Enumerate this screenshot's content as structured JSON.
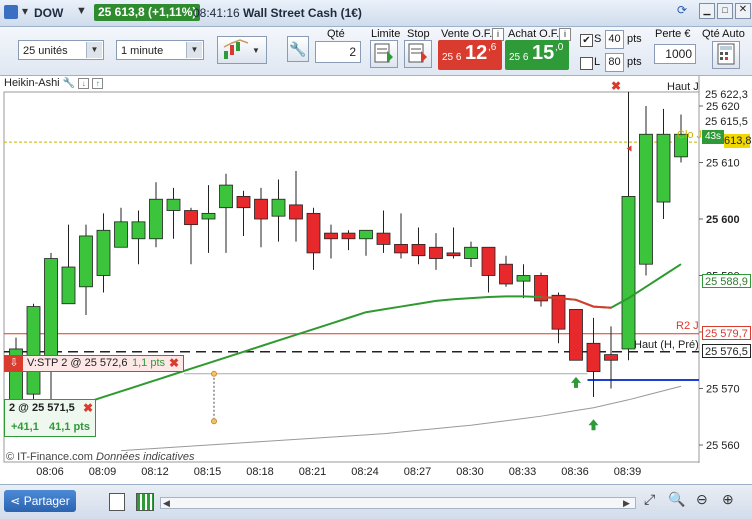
{
  "title_bar": {
    "instrument": "DOW",
    "price_change": "25 613,8 (+1,11%)",
    "time": "08:41:16",
    "name": "Wall Street Cash (1€)"
  },
  "toolbar": {
    "units_select": "25 unités",
    "interval_select": "1 minute",
    "qty_label": "Qté",
    "qty_value": "2",
    "limit_label": "Limite",
    "stop_label": "Stop",
    "sell_label": "Vente O.F.",
    "sell_prefix": "25 6",
    "sell_big": "12",
    "sell_sup": ",6",
    "buy_label": "Achat O.F.",
    "buy_prefix": "25 6",
    "buy_big": "15",
    "buy_sup": ",0",
    "s_label": "S",
    "s_value": "40",
    "l_label": "L",
    "l_value": "80",
    "pts_label": "pts",
    "perte_label": "Perte €",
    "perte_value": "1000",
    "qte_auto_label": "Qté Auto",
    "colors": {
      "sell": "#d93b2e",
      "buy": "#2f9a38"
    }
  },
  "chart": {
    "indicator_label": "Heikin-Ashi",
    "haut_j_label": "Haut J",
    "haut_h_label": "Haut (H, Pré)",
    "r2_label": "R2 J",
    "clo_label": "Clo J",
    "stop_order_label": "V:STP  2 @ 25 572,6",
    "stop_order_pts": "1,1 pts",
    "position_label": "2 @ 25 571,5",
    "position_pnl": "+41,1",
    "position_pts": "41,1 pts",
    "countdown": "43s",
    "footer_brand": "© IT-Finance.com",
    "footer_note": "Données indicatives",
    "price_tags": {
      "high": "25 622,3",
      "last": "25 615,5",
      "bid": "613,8",
      "ma": "25 588,9",
      "r2": "25 579,7",
      "haut_h": "25 576,5"
    }
  },
  "chart_data": {
    "type": "candlestick",
    "y_ticks": [
      25560,
      25570,
      25580,
      25590,
      25600,
      25610,
      25620
    ],
    "y_tick_labels": [
      "25 560",
      "25 570",
      "25 580",
      "25 590",
      "25 600",
      "25 610",
      "25 620"
    ],
    "x_tick_labels": [
      "08:06",
      "08:09",
      "08:12",
      "08:15",
      "08:18",
      "08:21",
      "08:24",
      "08:27",
      "08:30",
      "08:33",
      "08:36",
      "08:39"
    ],
    "ylim": [
      25555,
      25630
    ],
    "candles": [
      {
        "o": 25566.5,
        "h": 25579,
        "l": 25563,
        "c": 25577,
        "bull": true
      },
      {
        "o": 25569,
        "h": 25585,
        "l": 25565,
        "c": 25584.5,
        "bull": true
      },
      {
        "o": 25574,
        "h": 25594,
        "l": 25563,
        "c": 25593,
        "bull": true
      },
      {
        "o": 25585,
        "h": 25599,
        "l": 25585,
        "c": 25591.5,
        "bull": true
      },
      {
        "o": 25588,
        "h": 25599,
        "l": 25583,
        "c": 25597,
        "bull": true
      },
      {
        "o": 25590,
        "h": 25601,
        "l": 25587,
        "c": 25598,
        "bull": true
      },
      {
        "o": 25595,
        "h": 25602,
        "l": 25595,
        "c": 25599.5,
        "bull": true
      },
      {
        "o": 25596.5,
        "h": 25601.5,
        "l": 25592,
        "c": 25599.5,
        "bull": true
      },
      {
        "o": 25596.5,
        "h": 25606.5,
        "l": 25595,
        "c": 25603.5,
        "bull": true
      },
      {
        "o": 25603.5,
        "h": 25605.5,
        "l": 25596.5,
        "c": 25601.5,
        "bull": true
      },
      {
        "o": 25601.5,
        "h": 25602,
        "l": 25592,
        "c": 25599,
        "bull": false
      },
      {
        "o": 25600,
        "h": 25606,
        "l": 25594,
        "c": 25601,
        "bull": true
      },
      {
        "o": 25602,
        "h": 25608,
        "l": 25594,
        "c": 25606,
        "bull": true
      },
      {
        "o": 25604,
        "h": 25605,
        "l": 25597,
        "c": 25602,
        "bull": false
      },
      {
        "o": 25603.5,
        "h": 25605.5,
        "l": 25595,
        "c": 25600,
        "bull": false
      },
      {
        "o": 25600.5,
        "h": 25607,
        "l": 25596,
        "c": 25603.5,
        "bull": true
      },
      {
        "o": 25602.5,
        "h": 25608.5,
        "l": 25596,
        "c": 25600,
        "bull": false
      },
      {
        "o": 25601,
        "h": 25602,
        "l": 25591,
        "c": 25594,
        "bull": false
      },
      {
        "o": 25597.5,
        "h": 25599,
        "l": 25593,
        "c": 25596.5,
        "bull": false
      },
      {
        "o": 25597.5,
        "h": 25598,
        "l": 25594.5,
        "c": 25596.5,
        "bull": false
      },
      {
        "o": 25596.5,
        "h": 25598,
        "l": 25593.5,
        "c": 25598,
        "bull": true
      },
      {
        "o": 25597.5,
        "h": 25601.5,
        "l": 25594,
        "c": 25595.5,
        "bull": false
      },
      {
        "o": 25595.5,
        "h": 25601,
        "l": 25593,
        "c": 25594,
        "bull": false
      },
      {
        "o": 25595.5,
        "h": 25598.5,
        "l": 25592,
        "c": 25593.5,
        "bull": false
      },
      {
        "o": 25595,
        "h": 25597.5,
        "l": 25591,
        "c": 25593,
        "bull": false
      },
      {
        "o": 25594,
        "h": 25598.5,
        "l": 25593,
        "c": 25593.5,
        "bull": false
      },
      {
        "o": 25593,
        "h": 25596,
        "l": 25591.5,
        "c": 25595,
        "bull": true
      },
      {
        "o": 25595,
        "h": 25595,
        "l": 25587,
        "c": 25590,
        "bull": false
      },
      {
        "o": 25592,
        "h": 25593.5,
        "l": 25588,
        "c": 25588.5,
        "bull": false
      },
      {
        "o": 25589,
        "h": 25592,
        "l": 25586,
        "c": 25590,
        "bull": true
      },
      {
        "o": 25590,
        "h": 25590.5,
        "l": 25584.5,
        "c": 25585.5,
        "bull": false
      },
      {
        "o": 25586.5,
        "h": 25587,
        "l": 25578,
        "c": 25580.5,
        "bull": false
      },
      {
        "o": 25584,
        "h": 25584,
        "l": 25577.5,
        "c": 25575,
        "bull": false
      },
      {
        "o": 25578,
        "h": 25582.5,
        "l": 25568.5,
        "c": 25573,
        "bull": false
      },
      {
        "o": 25576,
        "h": 25581,
        "l": 25570,
        "c": 25575,
        "bull": false
      },
      {
        "o": 25577,
        "h": 25622.5,
        "l": 25575,
        "c": 25604,
        "bull": true
      },
      {
        "o": 25592,
        "h": 25620,
        "l": 25590,
        "c": 25615,
        "bull": true
      },
      {
        "o": 25603,
        "h": 25619.5,
        "l": 25600,
        "c": 25615,
        "bull": true
      },
      {
        "o": 25611,
        "h": 25618.5,
        "l": 25610,
        "c": 25615,
        "bull": true
      }
    ],
    "ma_green": [
      25561.5,
      25563,
      25564.5,
      25566,
      25567.5,
      25568.5,
      25569.5,
      25570.5,
      25571.5,
      25572.5,
      25573.5,
      25574.5,
      25575.5,
      25576.5,
      25577.5,
      25578.5,
      25579.5,
      25580.5,
      25581.5,
      25582.5,
      25583.5,
      25584,
      25584.5,
      25585,
      25585.5,
      25585.8,
      25586,
      25586.2,
      25586.3,
      25586.3,
      25586.2,
      25586,
      25585.7,
      25584.5,
      25584.3,
      25586,
      25588,
      25590,
      25592
    ],
    "ma_gray": [
      25559,
      25559.2,
      25559.4,
      25559.6,
      25559.8,
      25560,
      25560.2,
      25560.4,
      25560.6,
      25560.8,
      25561,
      25561.2,
      25561.4,
      25561.6,
      25561.8,
      25562,
      25562.3,
      25562.6,
      25562.9,
      25563.2,
      25563.5,
      25563.9,
      25564.3,
      25564.7,
      25565.1,
      25565.6,
      25566.1,
      25566.6,
      25567.3,
      25568,
      25568.8,
      25569.6,
      25570.4
    ],
    "levels": {
      "haut_j": 25625.7,
      "clo_j": 25613.6,
      "r2_j": 25579.7,
      "haut_h": 25576.5,
      "position": 25571.5
    }
  }
}
